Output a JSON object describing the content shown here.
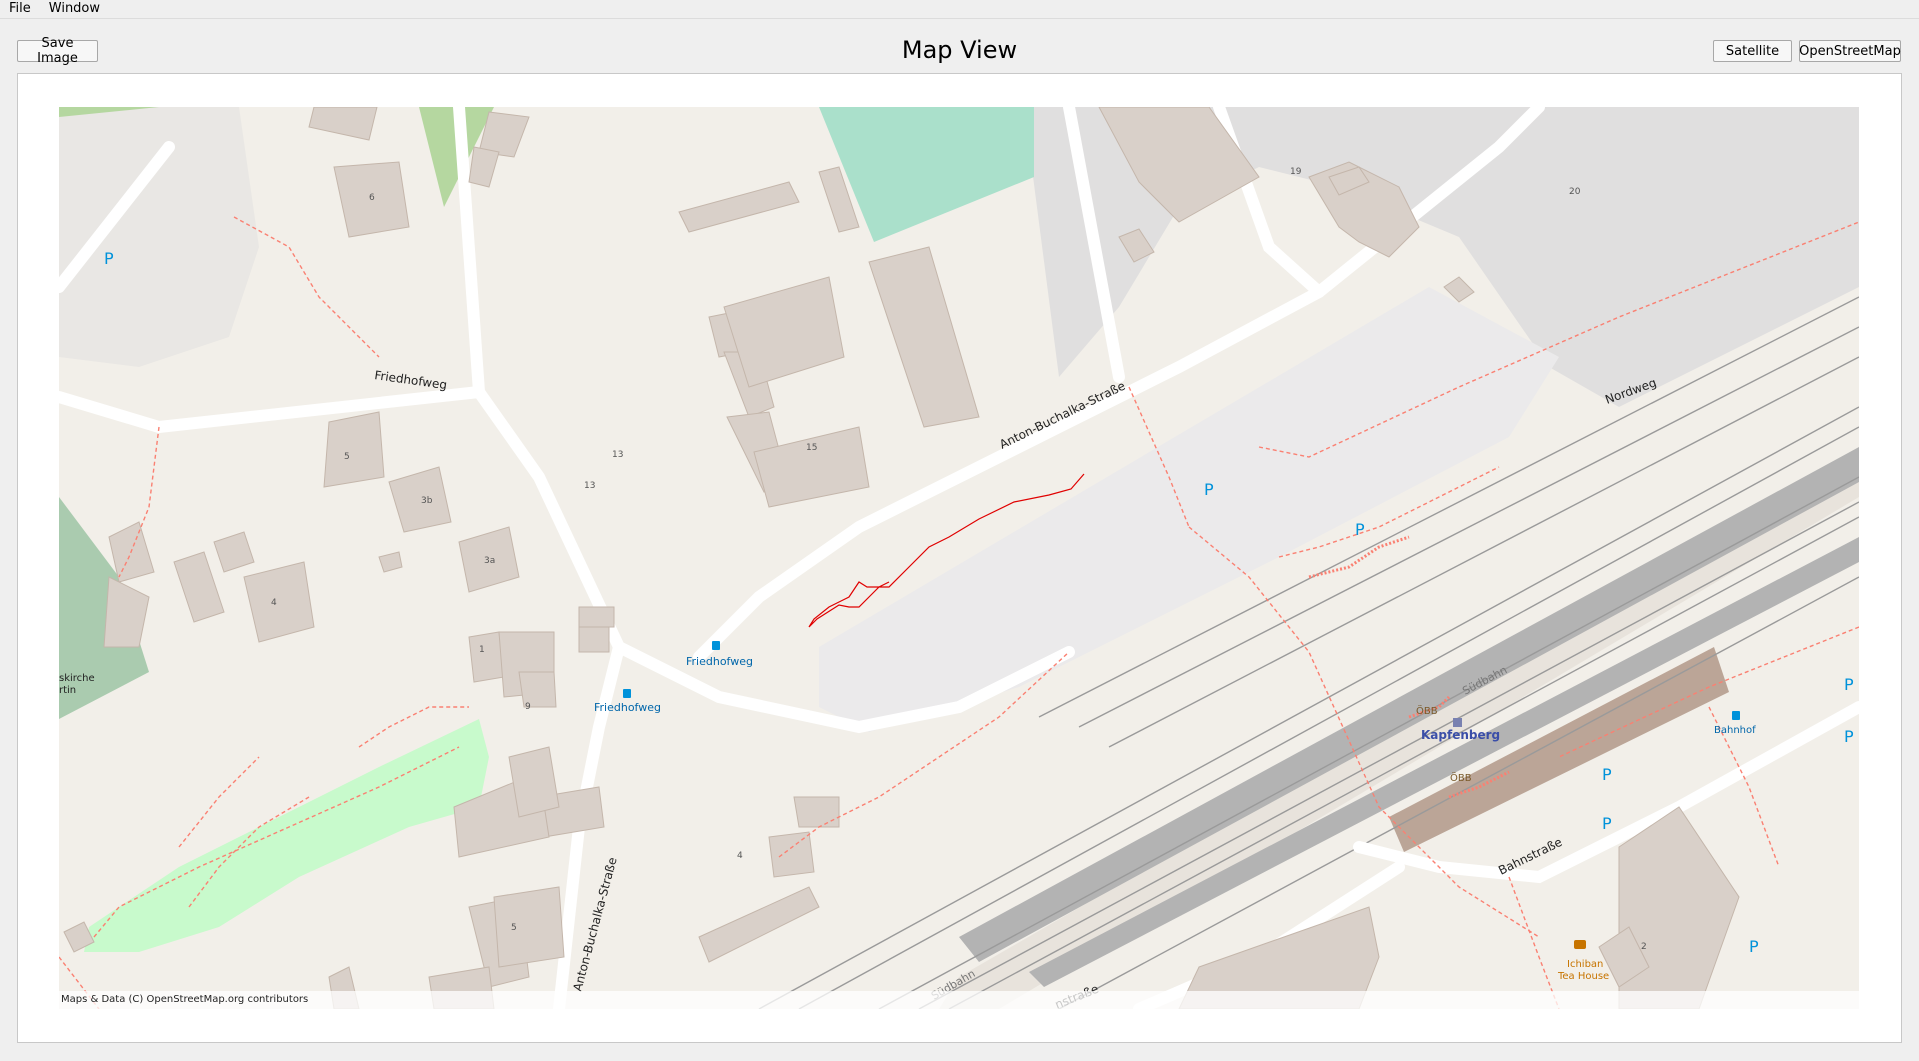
{
  "menu": {
    "file": "File",
    "window": "Window"
  },
  "toolbar": {
    "save_image": "Save Image",
    "title": "Map View",
    "satellite": "Satellite",
    "openstreetmap": "OpenStreetMap"
  },
  "map": {
    "attribution": "Maps & Data (C) OpenStreetMap.org contributors",
    "streets": {
      "friedhofweg": "Friedhofweg",
      "anton_upper": "Anton-Buchalka-Straße",
      "anton_lower": "Anton-Buchalka-Straße",
      "nordweg": "Nordweg",
      "bahnstrasse": "Bahnstraße",
      "bahnstrasse_partial": "nstraße",
      "suedbahn_upper": "Südbahn",
      "suedbahn_lower": "Südbahn"
    },
    "pois": {
      "bus_stop_1": "Friedhofweg",
      "bus_stop_2": "Friedhofweg",
      "bus_stop_3": "Bahnhof",
      "station": "Kapfenberg",
      "obb_1": "ÖBB",
      "obb_2": "ÖBB",
      "cafe_line1": "Ichiban",
      "cafe_line2": "Tea House",
      "church_line1": "skirche",
      "church_line2": "rtin"
    },
    "house_numbers": [
      "6",
      "19",
      "20",
      "5",
      "3b",
      "3a",
      "4",
      "13",
      "13",
      "15",
      "1",
      "9",
      "4",
      "5",
      "2"
    ],
    "parking_label": "P",
    "colors": {
      "background": "#f2efe9",
      "building": "#d9d0c9",
      "building_stroke": "#c4b6ab",
      "grass": "#cdebb0",
      "park": "#c8facc",
      "cemetery": "#aacbaf",
      "water_green": "#aae0cb",
      "industrial": "#e0dfdf",
      "railway": "#aaaaaa",
      "road_white": "#ffffff",
      "track_red": "#fa8072",
      "parking_blue": "#0092da",
      "gps_track": "#e00000"
    }
  }
}
